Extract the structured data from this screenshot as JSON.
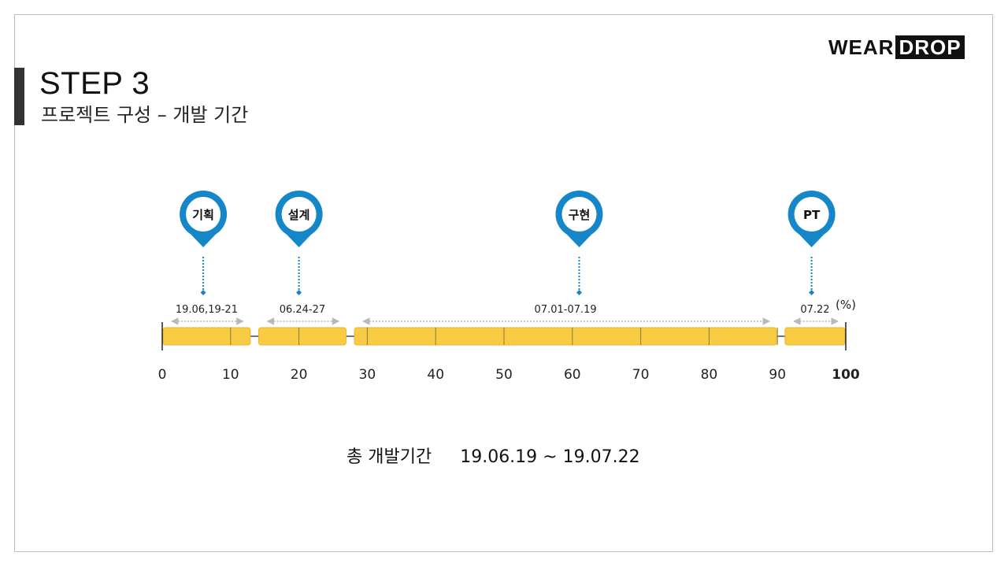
{
  "slide": {
    "title": "STEP 3",
    "subtitle": "프로젝트 구성 – 개발 기간",
    "logo": {
      "part1": "WEAR",
      "part2": "DROP"
    },
    "total_label": "총 개발기간",
    "total_value": "19.06.19 ~ 19.07.22"
  },
  "colors": {
    "bar": "#F9CB43",
    "bar_edge": "#E8B52E",
    "pin": "#1586C8",
    "dotted": "#1586C8",
    "arrow": "#B8B8B8",
    "axis": "#222222"
  },
  "chart_data": {
    "type": "timeline",
    "unit_label": "(%)",
    "xlim": [
      0,
      100
    ],
    "ticks": [
      0,
      10,
      20,
      30,
      40,
      50,
      60,
      70,
      80,
      90,
      100
    ],
    "bold_ticks": [
      100
    ],
    "phases": [
      {
        "name": "기획",
        "date": "19.06,19-21",
        "start": 0,
        "end": 13,
        "pin_at": 6
      },
      {
        "name": "설계",
        "date": "06.24-27",
        "start": 14,
        "end": 27,
        "pin_at": 20
      },
      {
        "name": "구현",
        "date": "07.01-07.19",
        "start": 28,
        "end": 90,
        "pin_at": 61
      },
      {
        "name": "PT",
        "date": "07.22",
        "start": 91,
        "end": 100,
        "pin_at": 95
      }
    ]
  }
}
